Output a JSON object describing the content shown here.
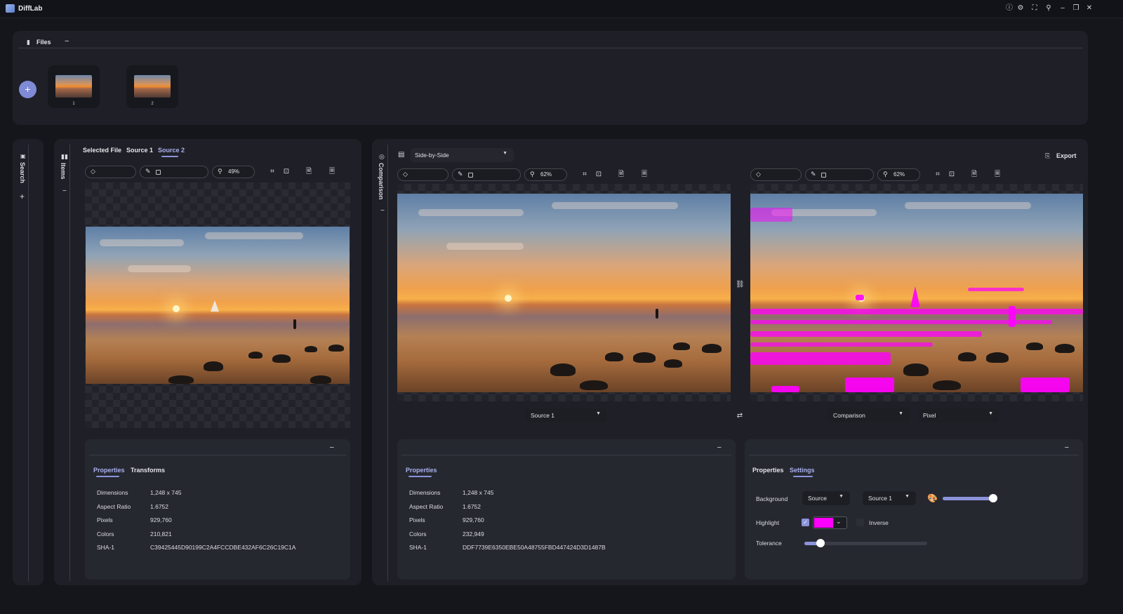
{
  "app": {
    "title": "DiffLab"
  },
  "titlebar_icons": [
    "info-icon",
    "gear-icon",
    "fullscreen-icon",
    "pin-icon",
    "minimize-icon",
    "restore-icon",
    "close-icon"
  ],
  "files": {
    "title": "Files",
    "collapse": "−",
    "add": "+",
    "thumbnails": [
      {
        "label": "1"
      },
      {
        "label": "2"
      }
    ]
  },
  "search_panel": {
    "label": "Search",
    "add": "+"
  },
  "items_panel": {
    "label": "Items",
    "collapse": "−"
  },
  "left_view": {
    "tabs": [
      "Selected File",
      "Source 1",
      "Source 2"
    ],
    "active_tab": "Source 2",
    "zoom": "49%"
  },
  "comparison_panel": {
    "label": "Comparison",
    "collapse": "−"
  },
  "compare": {
    "mode": "Side-by-Side",
    "export": "Export",
    "left_zoom": "62%",
    "right_zoom": "62%",
    "left_source": "Source 1",
    "right_source": "Comparison",
    "right_method": "Pixel"
  },
  "props_left": {
    "tabs": [
      "Properties",
      "Transforms"
    ],
    "collapse": "−",
    "rows": [
      {
        "label": "Dimensions",
        "value": "1,248 x 745"
      },
      {
        "label": "Aspect Ratio",
        "value": "1.6752"
      },
      {
        "label": "Pixels",
        "value": "929,760"
      },
      {
        "label": "Colors",
        "value": "210,821"
      },
      {
        "label": "SHA-1",
        "value": "C39425445D90199C2A4FCCDBE432AF6C26C19C1A"
      }
    ]
  },
  "props_mid": {
    "tabs": [
      "Properties"
    ],
    "collapse": "−",
    "rows": [
      {
        "label": "Dimensions",
        "value": "1,248 x 745"
      },
      {
        "label": "Aspect Ratio",
        "value": "1.6752"
      },
      {
        "label": "Pixels",
        "value": "929,760"
      },
      {
        "label": "Colors",
        "value": "232,949"
      },
      {
        "label": "SHA-1",
        "value": "DDF7739E6350EBE50A48755FBD447424D3D1487B"
      }
    ]
  },
  "settings": {
    "tabs": [
      "Properties",
      "Settings"
    ],
    "active_tab": "Settings",
    "collapse": "−",
    "background_label": "Background",
    "background_value": "Source",
    "background_source": "Source 1",
    "background_opacity": 0.92,
    "highlight_label": "Highlight",
    "highlight_checked": true,
    "highlight_color": "#ff00ff",
    "inverse_label": "Inverse",
    "tolerance_label": "Tolerance",
    "tolerance_value": 0.13
  },
  "colors": {
    "accent": "#8b93d9",
    "highlight": "#ff00ff"
  }
}
